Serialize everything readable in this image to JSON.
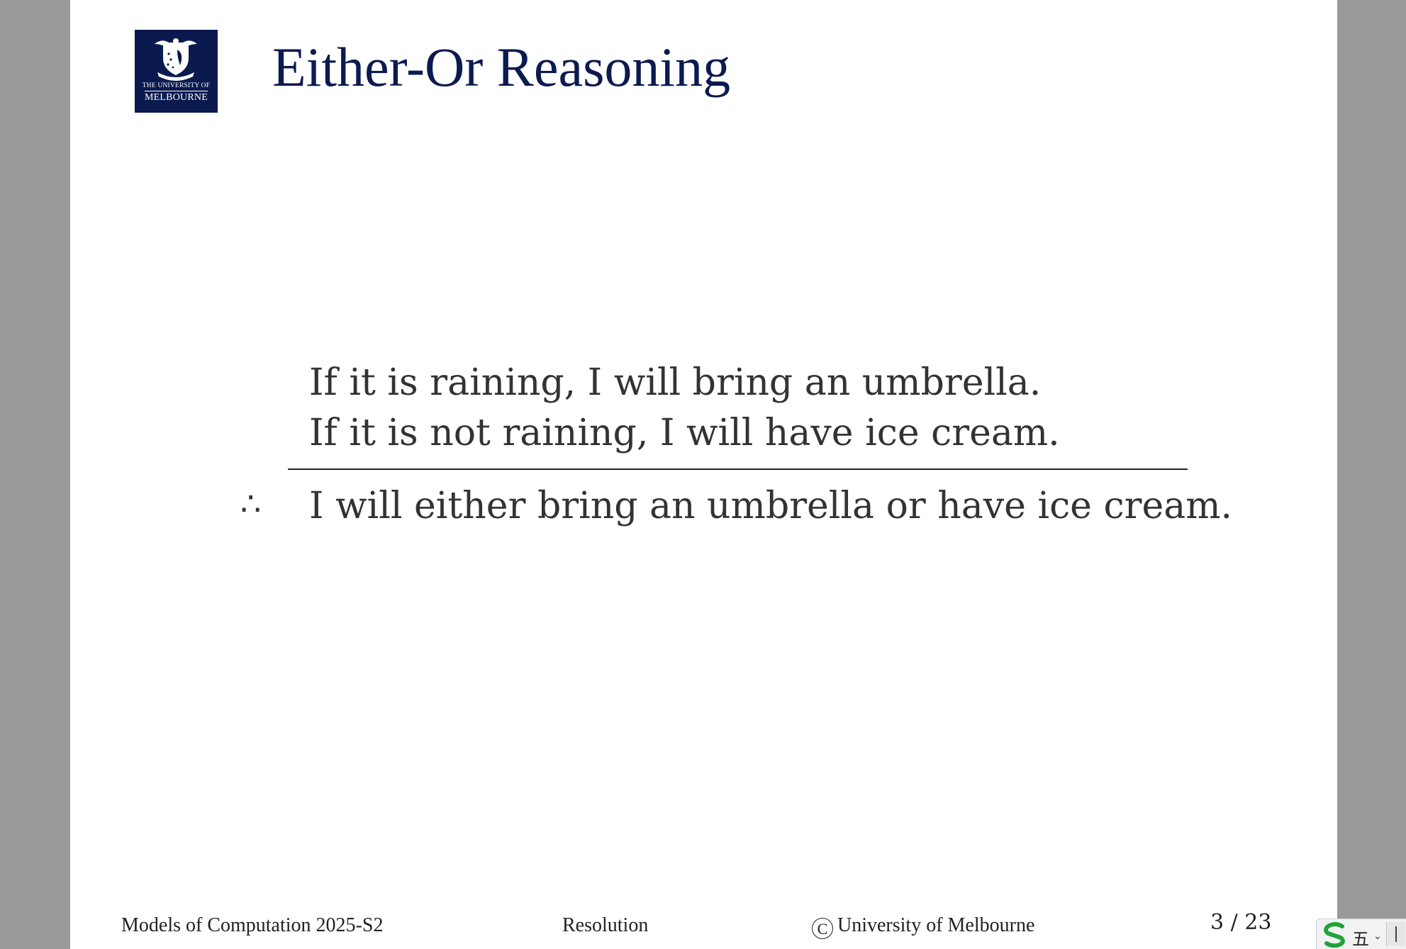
{
  "slide": {
    "logo": {
      "line1": "THE UNIVERSITY OF",
      "line2": "MELBOURNE"
    },
    "title": "Either-Or Reasoning",
    "argument": {
      "premises": [
        "If it is raining, I will bring an umbrella.",
        "If it is not raining, I will have ice cream."
      ],
      "therefore_symbol": "∴",
      "conclusion": "I will either bring an umbrella or have ice cream."
    },
    "footer": {
      "course": "Models of Computation 2025-S2",
      "topic": "Resolution",
      "copyright_symbol": "C",
      "copyright_holder": "University of Melbourne",
      "page": "3 / 23"
    }
  },
  "ime": {
    "mode_label": "五",
    "dropdown_glyph": "⌄"
  },
  "colors": {
    "viewer_background": "#9a9a9a",
    "title": "#0b1a4f",
    "logo_background": "#0a1a4f",
    "body_text": "#333333",
    "ime_logo": "#22a33a"
  }
}
